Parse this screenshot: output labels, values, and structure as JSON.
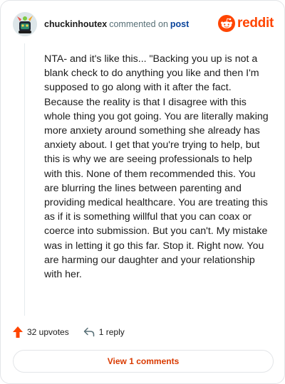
{
  "comment": {
    "username": "chuckinhoutex",
    "action_text": "commented on",
    "post_link": "post",
    "body": "NTA- and it's like this... \"Backing you up is not a blank check to do anything you like and then I'm supposed to go along with it after the fact. Because the reality is that I disagree with this whole thing you got going. You are literally making more anxiety around something she already has anxiety about. I get that you're trying to help, but this is why we are seeing professionals to help with this. None of them recommended this. You are blurring the lines between parenting and providing medical healthcare. You are treating this as if it is something willful that you can coax or coerce into submission. But you can't. My mistake was in letting it go this far. Stop it. Right now. You are harming our daughter and your relationship with her.",
    "upvotes": "32 upvotes",
    "replies": "1 reply",
    "view_comments": "View 1 comments"
  },
  "brand": {
    "name": "reddit",
    "color": "#ff4500",
    "icon": "reddit-snoo-icon"
  },
  "icons": {
    "upvote": "upvote-arrow-icon",
    "reply": "reply-arrow-icon"
  },
  "colors": {
    "upvote": "#ff4500",
    "link": "#0a449b",
    "view_button_text": "#d93a00"
  }
}
